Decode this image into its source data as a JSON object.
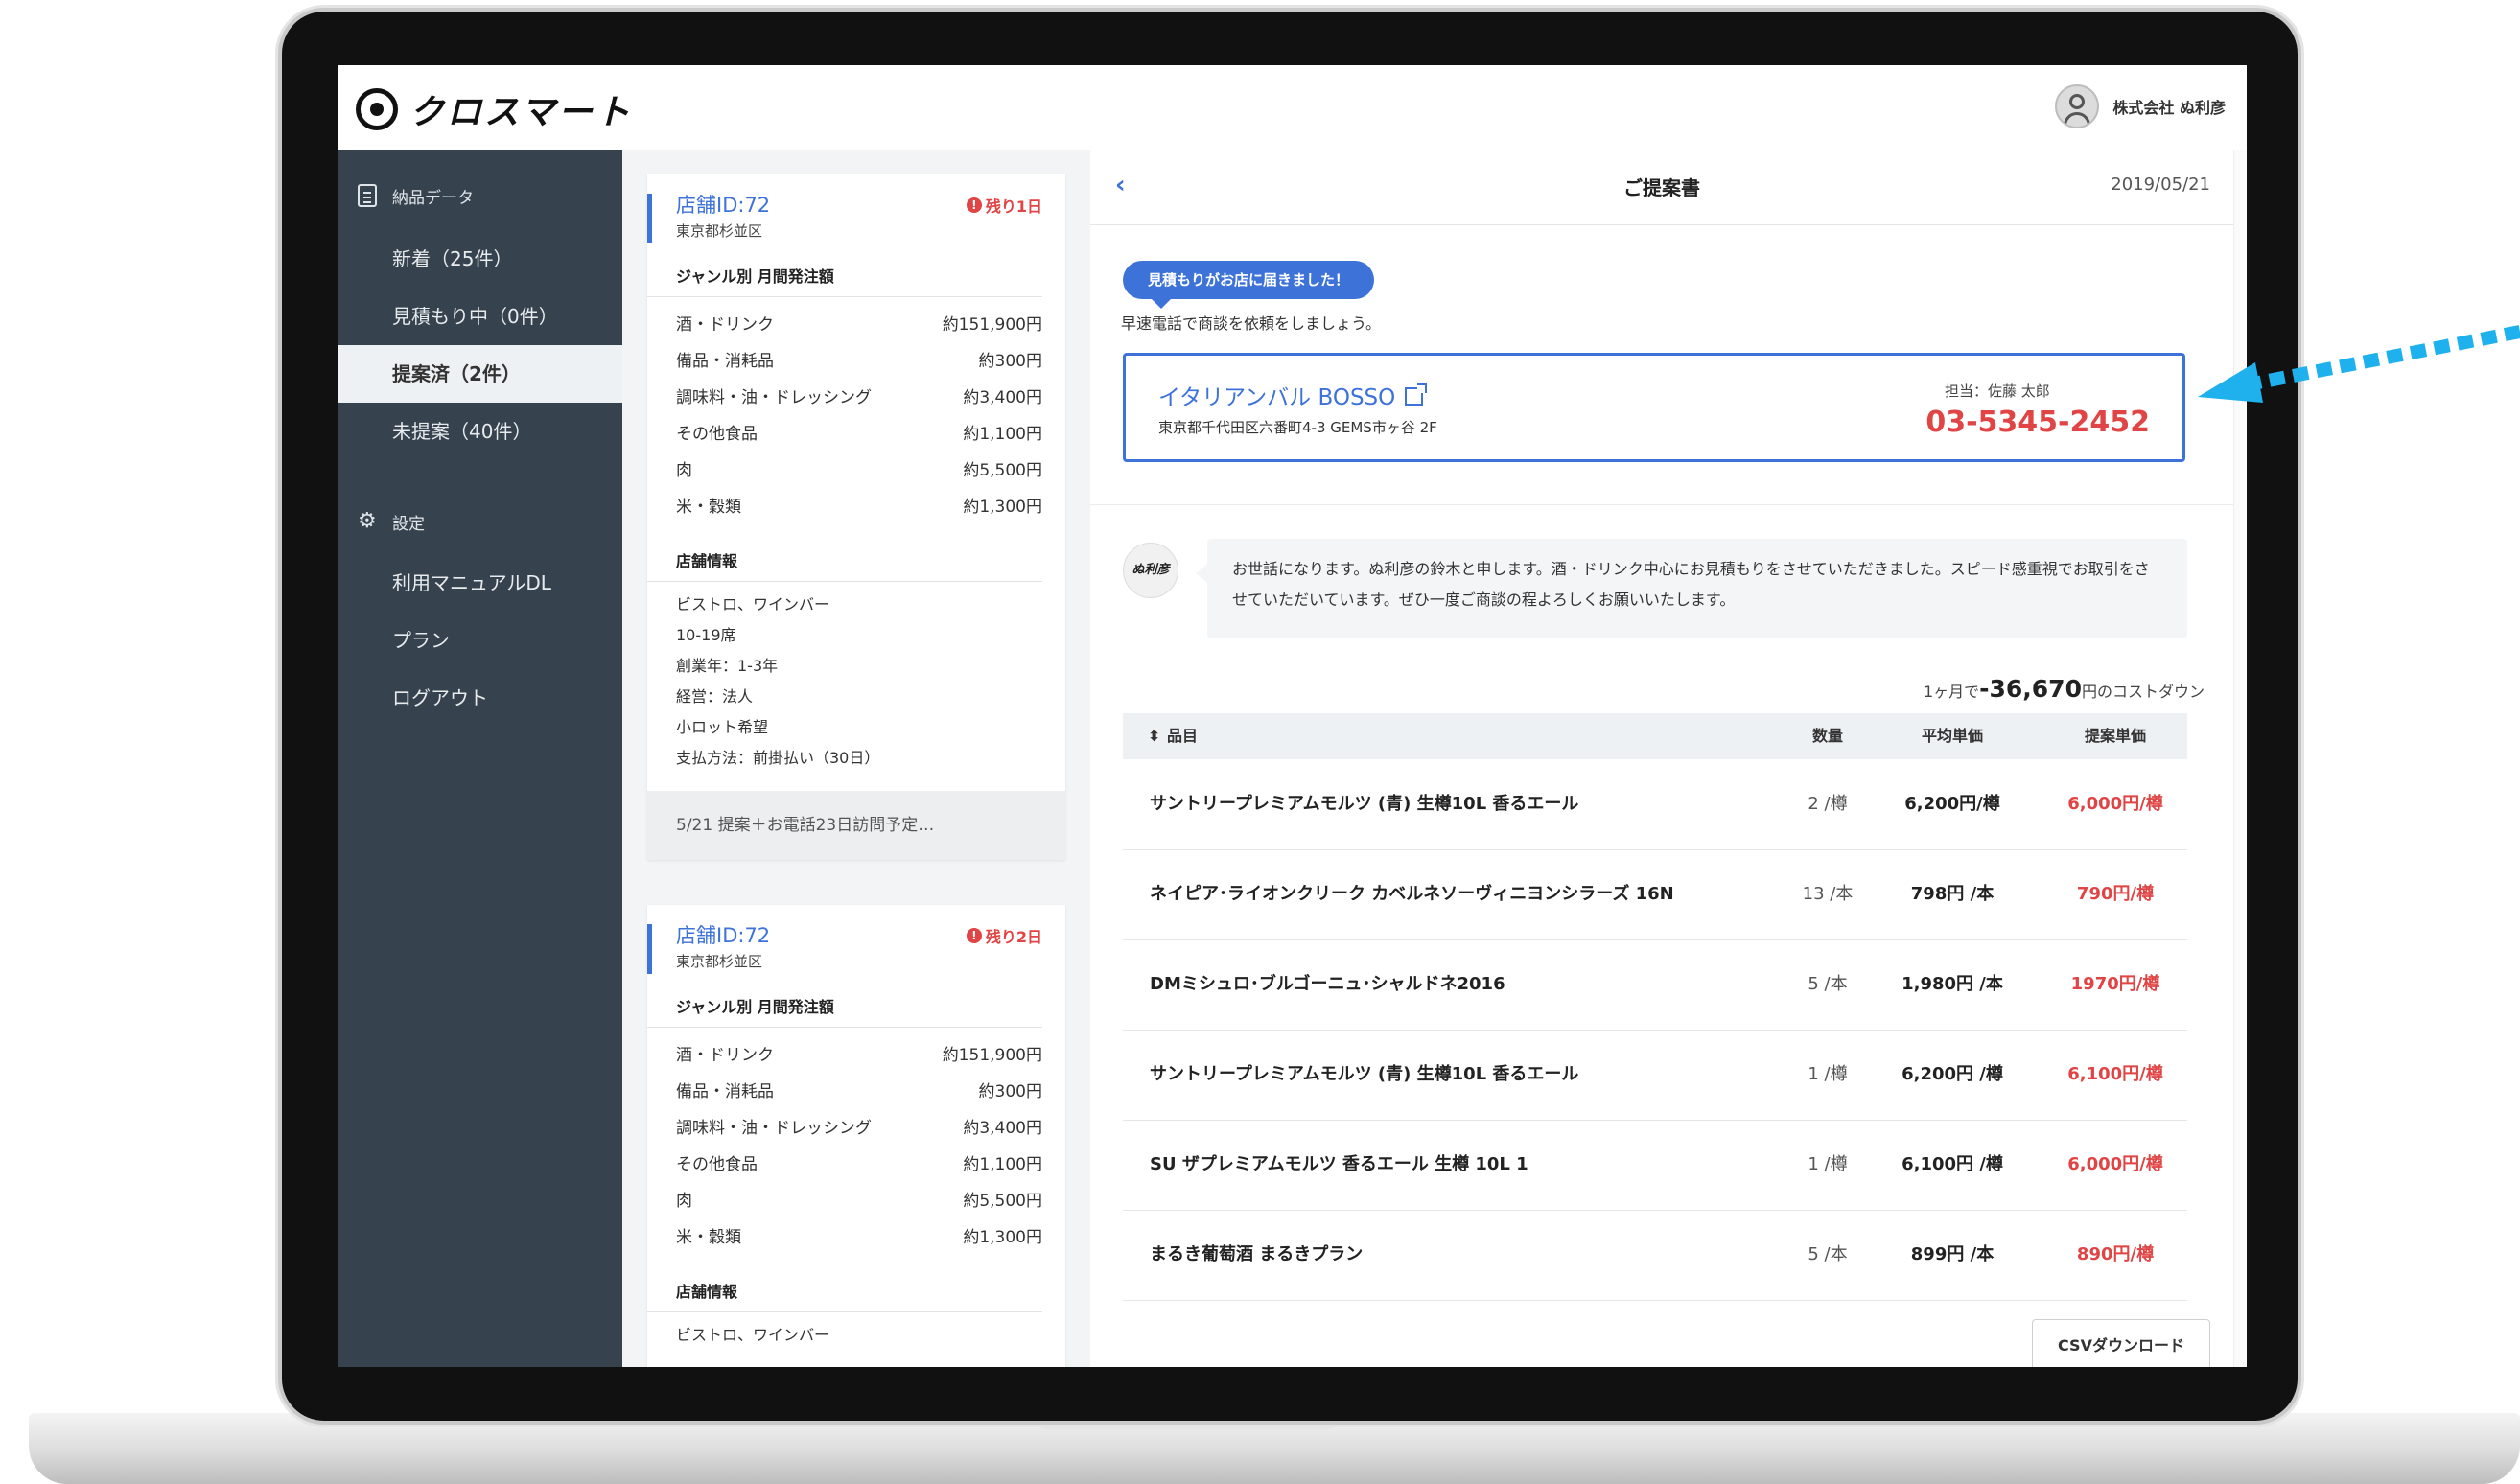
{
  "header": {
    "logo_text": "クロスマート",
    "company": "株式会社 ぬ利彦"
  },
  "sidebar": {
    "section1": "納品データ",
    "items": [
      {
        "label": "新着（25件）"
      },
      {
        "label": "見積もり中（0件）"
      },
      {
        "label": "提案済（2件）"
      },
      {
        "label": "未提案（40件）"
      }
    ],
    "section2": "設定",
    "settings": [
      {
        "label": "利用マニュアルDL"
      },
      {
        "label": "プラン"
      },
      {
        "label": "ログアウト"
      }
    ]
  },
  "cards": [
    {
      "store_id": "店舗ID:72",
      "area": "東京都杉並区",
      "remain": "残り1日",
      "genre_title": "ジャンル別 月間発注額",
      "rows": [
        {
          "label": "酒・ドリンク",
          "value": "約151,900円"
        },
        {
          "label": "備品・消耗品",
          "value": "約300円"
        },
        {
          "label": "調味料・油・ドレッシング",
          "value": "約3,400円"
        },
        {
          "label": "その他食品",
          "value": "約1,100円"
        },
        {
          "label": "肉",
          "value": "約5,500円"
        },
        {
          "label": "米・穀類",
          "value": "約1,300円"
        }
      ],
      "info_title": "店舗情報",
      "info": [
        "ビストロ、ワインバー",
        "10-19席",
        "創業年：1-3年",
        "経営：法人",
        "小ロット希望",
        "支払方法：前掛払い（30日）"
      ],
      "footer": "5/21 提案＋お電話23日訪問予定…"
    },
    {
      "store_id": "店舗ID:72",
      "area": "東京都杉並区",
      "remain": "残り2日",
      "genre_title": "ジャンル別 月間発注額",
      "rows": [
        {
          "label": "酒・ドリンク",
          "value": "約151,900円"
        },
        {
          "label": "備品・消耗品",
          "value": "約300円"
        },
        {
          "label": "調味料・油・ドレッシング",
          "value": "約3,400円"
        },
        {
          "label": "その他食品",
          "value": "約1,100円"
        },
        {
          "label": "肉",
          "value": "約5,500円"
        },
        {
          "label": "米・穀類",
          "value": "約1,300円"
        }
      ],
      "info_title": "店舗情報",
      "info": [
        "ビストロ、ワインバー"
      ]
    }
  ],
  "detail": {
    "back": "‹",
    "title": "ご提案書",
    "date": "2019/05/21",
    "bubble": "見積もりがお店に届きました！",
    "sub": "早速電話で商談を依頼をしましょう。",
    "store_name": "イタリアンバル BOSSO",
    "store_address": "東京都千代田区六番町4-3 GEMS市ヶ谷 2F",
    "tanto": "担当：佐藤 太郎",
    "phone": "03-5345-2452",
    "seal_text": "ぬ利彦",
    "message": "お世話になります。ぬ利彦の鈴木と申します。酒・ドリンク中心にお見積もりをさせていただきました。スピード感重視でお取引をさせていただいています。ぜひ一度ご商談の程よろしくお願いいたします。",
    "costdown_prefix": "1ヶ月で",
    "costdown_value": "-36,670",
    "costdown_suffix": "円のコストダウン",
    "table_headers": {
      "item": "品目",
      "qty": "数量",
      "avg": "平均単価",
      "prop": "提案単価"
    },
    "rows": [
      {
        "name": "サントリープレミアムモルツ (青) 生樽10L 香るエール",
        "qty": "2 /樽",
        "avg": "6,200円/樽",
        "prop": "6,000円/樽"
      },
      {
        "name": "ネイピア･ライオンクリーク カベルネソーヴィニヨンシラーズ 16N",
        "qty": "13 /本",
        "avg": "798円 /本",
        "prop": "790円/樽"
      },
      {
        "name": "DMミシュロ･ブルゴーニュ･シャルドネ2016",
        "qty": "5 /本",
        "avg": "1,980円 /本",
        "prop": "1970円/樽"
      },
      {
        "name": "サントリープレミアムモルツ (青) 生樽10L 香るエール",
        "qty": "1 /樽",
        "avg": "6,200円 /樽",
        "prop": "6,100円/樽"
      },
      {
        "name": "SU ザプレミアムモルツ 香るエール 生樽 10L 1",
        "qty": "1 /樽",
        "avg": "6,100円 /樽",
        "prop": "6,000円/樽"
      },
      {
        "name": "まるき葡萄酒 まるきプラン",
        "qty": "5 /本",
        "avg": "899円 /本",
        "prop": "890円/樽"
      }
    ],
    "csv_button": "CSVダウンロード"
  },
  "colors": {
    "accent": "#3d72d9",
    "alert": "#e04444",
    "sidebar": "#36424e"
  }
}
